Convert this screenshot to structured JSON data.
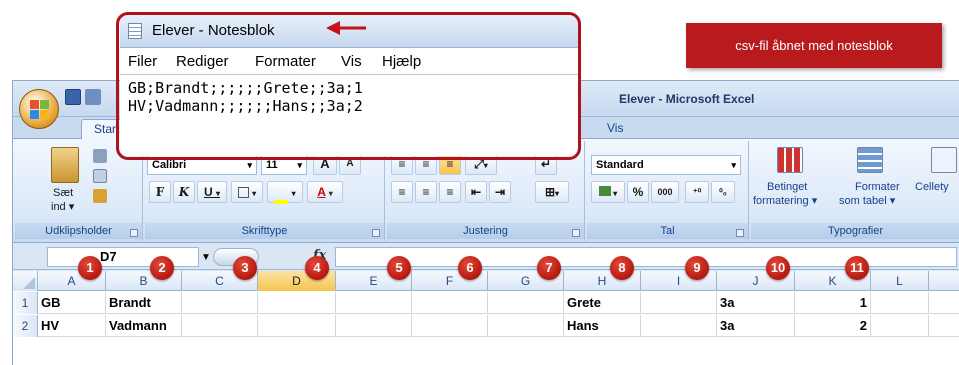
{
  "callout": {
    "text": "csv-fil åbnet med notesblok"
  },
  "notepad": {
    "title": "Elever - Notesblok",
    "menu": [
      "Filer",
      "Rediger",
      "Formater",
      "Vis",
      "Hjælp"
    ],
    "lines": [
      "GB;Brandt;;;;;;Grete;;3a;1",
      "HV;Vadmann;;;;;;Hans;;3a;2"
    ]
  },
  "excel": {
    "title": "Elever - Microsoft Excel",
    "tabs": {
      "start": "Start",
      "vis": "Vis"
    },
    "clipboard": {
      "paste": "Sæt",
      "paste2": "ind",
      "label": "Udklipsholder"
    },
    "font": {
      "name": "Calibri",
      "size": "11",
      "grow": "A",
      "shrink": "A",
      "bold": "F",
      "italic": "K",
      "underline": "U",
      "label": "Skrifttype"
    },
    "alignment": {
      "label": "Justering"
    },
    "number": {
      "format": "Standard",
      "percent": "%",
      "thousands": "000",
      "label": "Tal"
    },
    "styles": {
      "conditional": "Betinget",
      "conditional2": "formatering",
      "table": "Formater",
      "table2": "som tabel",
      "cell": "Cellety",
      "label": "Typografier"
    },
    "formula_bar": {
      "name_box": "D7",
      "fx": "fx",
      "value": ""
    },
    "columns": [
      "A",
      "B",
      "C",
      "D",
      "E",
      "F",
      "G",
      "H",
      "I",
      "J",
      "K",
      "L"
    ],
    "rows": [
      {
        "num": "1",
        "cells": [
          "GB",
          "Brandt",
          "",
          "",
          "",
          "",
          "",
          "Grete",
          "",
          "3a",
          "1",
          ""
        ]
      },
      {
        "num": "2",
        "cells": [
          "HV",
          "Vadmann",
          "",
          "",
          "",
          "",
          "",
          "Hans",
          "",
          "3a",
          "2",
          ""
        ]
      }
    ]
  },
  "badges": [
    "1",
    "2",
    "3",
    "4",
    "5",
    "6",
    "7",
    "8",
    "9",
    "10",
    "11"
  ],
  "colors": {
    "accent_red": "#b81a1e",
    "selected_col": "#f7c44f",
    "ribbon_blue": "#dbe8f8"
  }
}
